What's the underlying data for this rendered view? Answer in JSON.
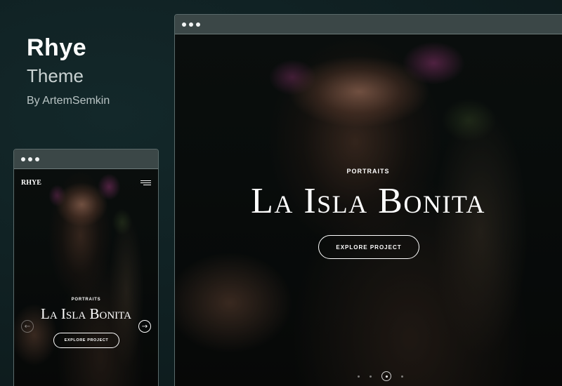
{
  "branding": {
    "name": "Rhye",
    "subtitle": "Theme",
    "author": "By ArtemSemkin"
  },
  "desktop_preview": {
    "category": "PORTRAITS",
    "title": "La Isla Bonita",
    "button_label": "EXPLORE PROJECT",
    "slides_total": 4,
    "active_slide": 3
  },
  "mobile_preview": {
    "logo": "RHYE",
    "category": "PORTRAITS",
    "title": "La Isla Bonita",
    "button_label": "EXPLORE PROJECT",
    "prev_icon": "arrow-left-icon",
    "next_icon": "arrow-right-icon",
    "menu_icon": "hamburger-menu-icon"
  },
  "colors": {
    "background": "#0f1f21",
    "titlebar": "#3b4747",
    "text": "#ffffff"
  }
}
